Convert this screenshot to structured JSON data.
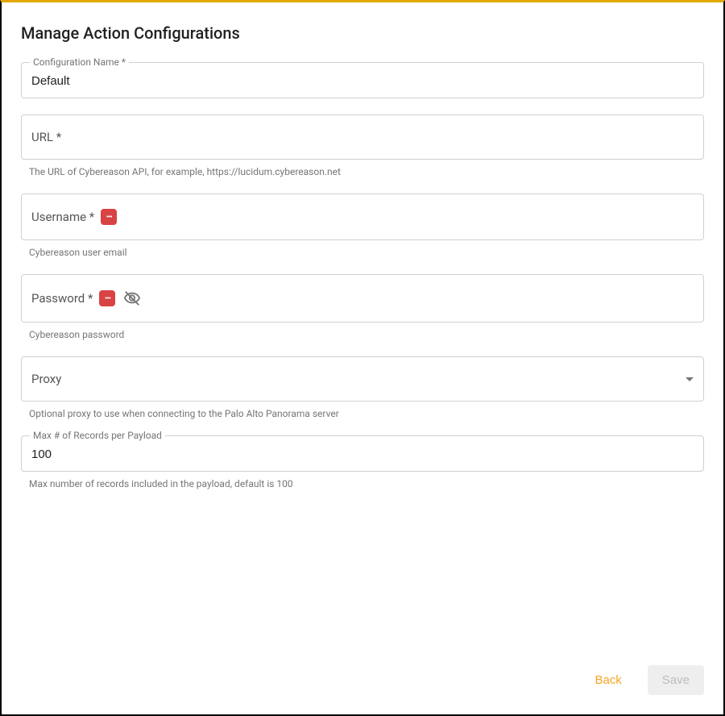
{
  "page": {
    "title": "Manage Action Configurations"
  },
  "fields": {
    "configName": {
      "label": "Configuration Name *",
      "value": "Default"
    },
    "url": {
      "label": "URL *",
      "value": "",
      "helper": "The URL of Cybereason API, for example, https://lucidum.cybereason.net"
    },
    "username": {
      "label": "Username *",
      "value": "",
      "helper": "Cybereason user email"
    },
    "password": {
      "label": "Password *",
      "value": "",
      "helper": "Cybereason password"
    },
    "proxy": {
      "label": "Proxy",
      "helper": "Optional proxy to use when connecting to the Palo Alto Panorama server"
    },
    "maxRecords": {
      "label": "Max # of Records per Payload",
      "value": "100",
      "helper": "Max number of records included in the payload, default is 100"
    }
  },
  "footer": {
    "back": "Back",
    "save": "Save"
  }
}
